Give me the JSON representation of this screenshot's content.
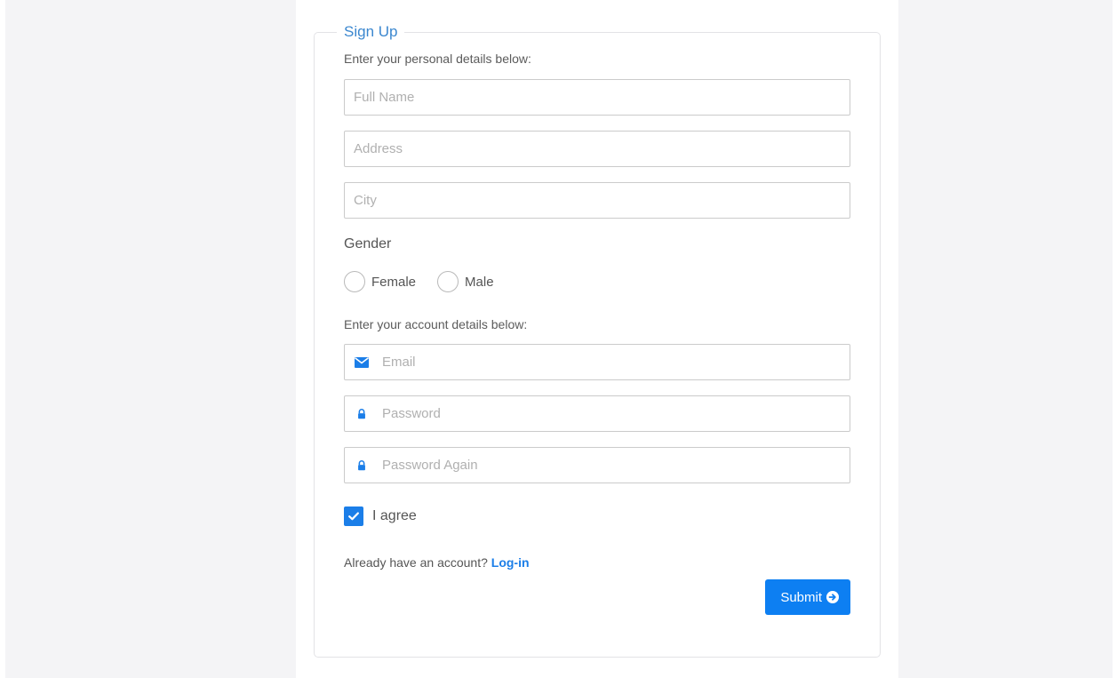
{
  "form": {
    "title": "Sign Up",
    "personal_label": "Enter your personal details below:",
    "fields": {
      "full_name": {
        "placeholder": "Full Name"
      },
      "address": {
        "placeholder": "Address"
      },
      "city": {
        "placeholder": "City"
      }
    },
    "gender": {
      "label": "Gender",
      "options": [
        "Female",
        "Male"
      ]
    },
    "account_label": "Enter your account details below:",
    "account_fields": {
      "email": {
        "placeholder": "Email",
        "icon": "envelope-icon"
      },
      "password": {
        "placeholder": "Password",
        "icon": "lock-icon"
      },
      "password_again": {
        "placeholder": "Password Again",
        "icon": "lock-icon"
      }
    },
    "agree": {
      "label": "I agree",
      "checked": true
    },
    "login_prompt": "Already have an account?",
    "login_link": "Log-in",
    "submit_label": "Submit"
  },
  "colors": {
    "accent": "#0d7ff2",
    "title": "#3b87cf",
    "side_panel": "#f4f4f6"
  }
}
